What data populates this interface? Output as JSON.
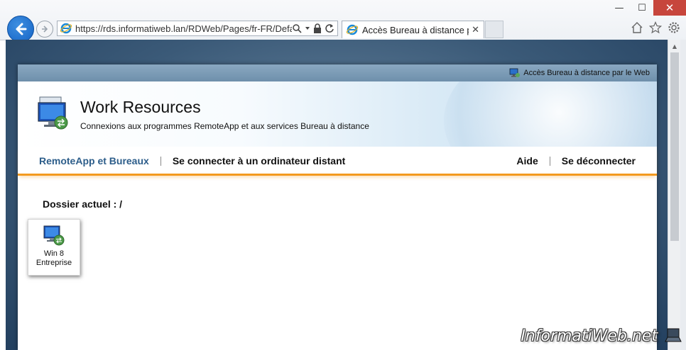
{
  "browser": {
    "url": "https://rds.informatiweb.lan/RDWeb/Pages/fr-FR/Default",
    "url_host": "rds.informatiweb.lan",
    "tab_title": "Accès Bureau à distance pa...",
    "window_controls": {
      "minimize": "—",
      "maximize": "☐",
      "close": "✕"
    },
    "tab_close": "✕"
  },
  "page": {
    "topbar_link": "Accès Bureau à distance par le Web",
    "title": "Work Resources",
    "subtitle": "Connexions aux programmes RemoteApp et aux services Bureau à distance",
    "nav": {
      "left": [
        "RemoteApp et Bureaux",
        "Se connecter à un ordinateur distant"
      ],
      "right": [
        "Aide",
        "Se déconnecter"
      ],
      "active": "RemoteApp et Bureaux"
    },
    "folder_label": "Dossier actuel : /",
    "apps": [
      {
        "name_line1": "Win 8",
        "name_line2": "Entreprise",
        "icon": "remote-desktop-icon"
      }
    ]
  },
  "watermark": "InformatiWeb.net",
  "colors": {
    "accent_orange": "#f39a1f",
    "active_nav": "#2c5d8a",
    "topbar": "#7b9ab5",
    "close_button": "#c7463c"
  }
}
